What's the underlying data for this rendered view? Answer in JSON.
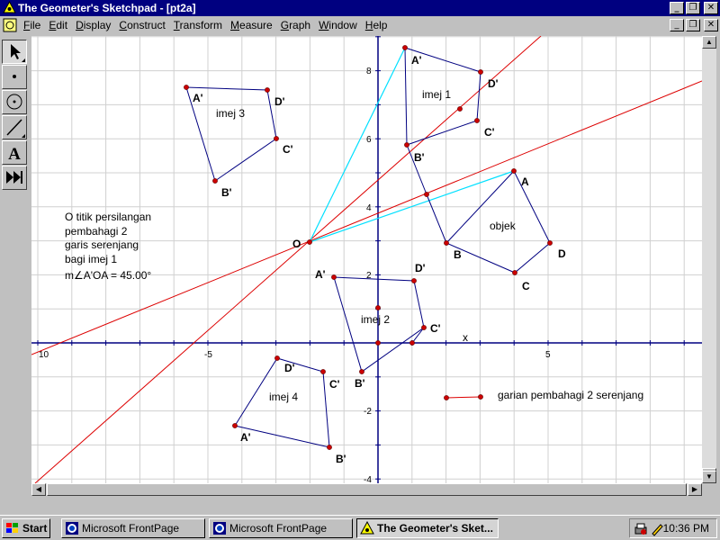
{
  "window": {
    "title": "The Geometer's Sketchpad - [pt2a]",
    "controls": [
      "_",
      "❐",
      "✕"
    ]
  },
  "menubar": {
    "items": [
      "File",
      "Edit",
      "Display",
      "Construct",
      "Transform",
      "Measure",
      "Graph",
      "Window",
      "Help"
    ],
    "doc_controls": [
      "_",
      "❐",
      "✕"
    ]
  },
  "toolbox": {
    "tools": [
      "select-arrow-icon",
      "point-icon",
      "compass-icon",
      "straightedge-icon",
      "text-icon",
      "script-icon"
    ],
    "text_tool_label": "A",
    "active_tool": "select-arrow-icon"
  },
  "sketch": {
    "x_axis_label": "x",
    "x_tick_labels": [
      "10",
      "-5",
      "5"
    ],
    "y_tick_labels": [
      "8",
      "6",
      "4",
      "2",
      "-2",
      "-4"
    ],
    "grid": true,
    "colors": {
      "lines": "#dd0000",
      "cyan": "#00e0ff",
      "poly": "#000080",
      "point": "#cc0000",
      "grid": "#d0d0d0"
    },
    "origin_label": "O",
    "object_label": "objek",
    "object_points": [
      "A",
      "B",
      "C",
      "D"
    ],
    "image_labels": {
      "imej1": "imej 1",
      "imej2": "imej 2",
      "imej3": "imej 3",
      "imej4": "imej 4"
    },
    "image_point_labels": [
      "A'",
      "B'",
      "C'",
      "D'"
    ],
    "note_lines": [
      "O titik persilangan",
      "pembahagi  2",
      "garis serenjang",
      "bagi imej 1"
    ],
    "measurement": "m∠A'OA = 45.00°",
    "legend_label": "garian pembahagi 2 serenjang"
  },
  "taskbar": {
    "start_label": "Start",
    "tasks": [
      "Microsoft FrontPage",
      "Microsoft FrontPage",
      "The Geometer's Sket..."
    ],
    "active_task": 2,
    "clock": "10:36 PM"
  }
}
